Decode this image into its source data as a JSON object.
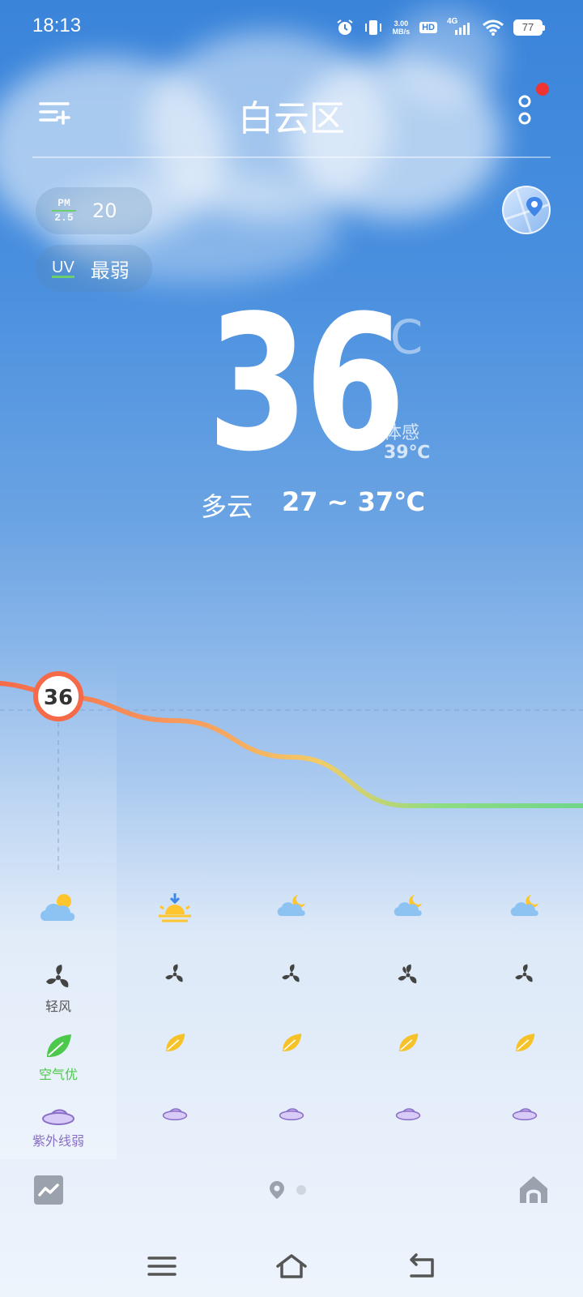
{
  "status_bar": {
    "time": "18:13",
    "net_speed_value": "3.00",
    "net_speed_unit": "MB/s",
    "hd": "HD",
    "signal_type": "4G",
    "battery": "77"
  },
  "header": {
    "city": "白云区"
  },
  "air": {
    "pm_label_top": "PM",
    "pm_label_bottom": "2.5",
    "pm_value": "20",
    "uv_label": "UV",
    "uv_value": "最弱"
  },
  "current": {
    "temperature": "36",
    "unit": "℃",
    "feels_like_label": "体感",
    "feels_like": "39℃",
    "condition": "多云",
    "range": "27 ~ 37℃"
  },
  "hourly": {
    "now_temp": "36",
    "temps_chart": [
      36,
      34,
      31,
      27,
      27
    ],
    "columns": [
      {
        "weather_icon": "cloudy-sun-icon",
        "wind_label": "轻风",
        "air_label": "空气优",
        "uv_label": "紫外线弱"
      },
      {
        "weather_icon": "sunset-icon",
        "wind_label": "",
        "air_label": "",
        "uv_label": ""
      },
      {
        "weather_icon": "cloudy-moon-icon",
        "wind_label": "",
        "air_label": "",
        "uv_label": ""
      },
      {
        "weather_icon": "cloudy-moon-icon",
        "wind_label": "",
        "air_label": "",
        "uv_label": ""
      },
      {
        "weather_icon": "cloudy-moon-icon",
        "wind_label": "",
        "air_label": "",
        "uv_label": ""
      }
    ]
  },
  "colors": {
    "sky_top": "#3a84da",
    "curve_hot": "#f56b4a",
    "curve_mid": "#f7c160",
    "curve_cool": "#6fd68a",
    "air_green": "#4cc84c",
    "uv_purple": "#8a6fc8",
    "alert_red": "#f03434"
  }
}
